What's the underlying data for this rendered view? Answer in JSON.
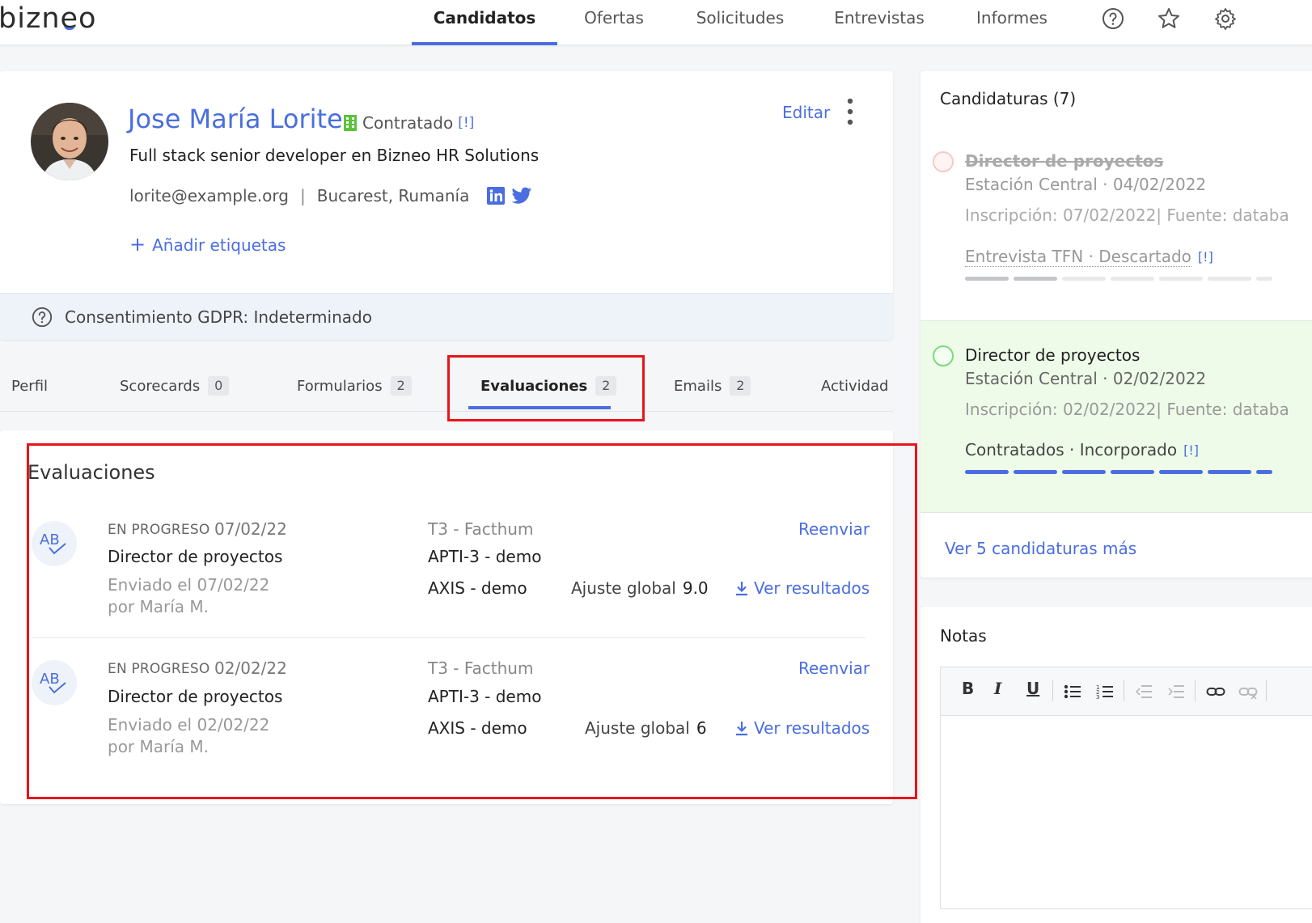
{
  "brand": {
    "logo_prefix": "bizn",
    "logo_e": "e",
    "logo_suffix": "o"
  },
  "nav": {
    "candidatos": "Candidatos",
    "ofertas": "Ofertas",
    "solicitudes": "Solicitudes",
    "entrevistas": "Entrevistas",
    "informes": "Informes"
  },
  "header_icons": [
    "help-icon",
    "star-icon",
    "settings-icon"
  ],
  "candidate": {
    "name": "Jose María Lorite",
    "status": "Contratado",
    "status_flag": "[!]",
    "headline": "Full stack senior developer en Bizneo HR Solutions",
    "email": "lorite@example.org",
    "separator": "|",
    "location": "Bucarest, Rumanía",
    "add_tags": "Añadir etiquetas",
    "edit": "Editar"
  },
  "gdpr": {
    "text": "Consentimiento GDPR: Indeterminado"
  },
  "tabs": {
    "perfil": {
      "label": "Perfil"
    },
    "scorecards": {
      "label": "Scorecards",
      "count": "0"
    },
    "formularios": {
      "label": "Formularios",
      "count": "2"
    },
    "evaluaciones": {
      "label": "Evaluaciones",
      "count": "2"
    },
    "emails": {
      "label": "Emails",
      "count": "2"
    },
    "actividad": {
      "label": "Actividad"
    }
  },
  "evaluations": {
    "title": "Evaluaciones",
    "items": [
      {
        "icon_text": "AB",
        "status": "EN PROGRESO",
        "date": "07/02/22",
        "role": "Director de proyectos",
        "sent": "Enviado el 07/02/22",
        "by": "por María M.",
        "company": "T3 - Facthum",
        "test1": "APTI-3 - demo",
        "test2": "AXIS - demo",
        "score_label": "Ajuste global",
        "score": "9.0",
        "resend": "Reenviar",
        "results": "Ver resultados"
      },
      {
        "icon_text": "AB",
        "status": "EN PROGRESO",
        "date": "02/02/22",
        "role": "Director de proyectos",
        "sent": "Enviado el 02/02/22",
        "by": "por María M.",
        "company": "T3 - Facthum",
        "test1": "APTI-3 - demo",
        "test2": "AXIS - demo",
        "score_label": "Ajuste global",
        "score": "6",
        "resend": "Reenviar",
        "results": "Ver resultados"
      }
    ]
  },
  "applications": {
    "title": "Candidaturas (7)",
    "items": [
      {
        "role": "Director de proyectos",
        "place_date": "Estación Central · 04/02/2022",
        "inscription": "Inscripción: 07/02/2022| Fuente: databa",
        "stage": "Entrevista TFN · Descartado",
        "flag": "[!]",
        "state": "discarded",
        "progress_done": 2
      },
      {
        "role": "Director de proyectos",
        "place_date": "Estación Central · 02/02/2022",
        "inscription": "Inscripción: 02/02/2022| Fuente: databa",
        "stage": "Contratados · Incorporado",
        "flag": "[!]",
        "state": "hired",
        "progress_done": 7
      }
    ],
    "more": "Ver 5 candidaturas más"
  },
  "notes": {
    "title": "Notas"
  },
  "colors": {
    "accent": "#4a6ee0",
    "hired_bg": "#eefbe9",
    "hired_ring": "#7bd97b",
    "discarded_ring": "#f7c9c9",
    "highlight": "#e8141a"
  }
}
